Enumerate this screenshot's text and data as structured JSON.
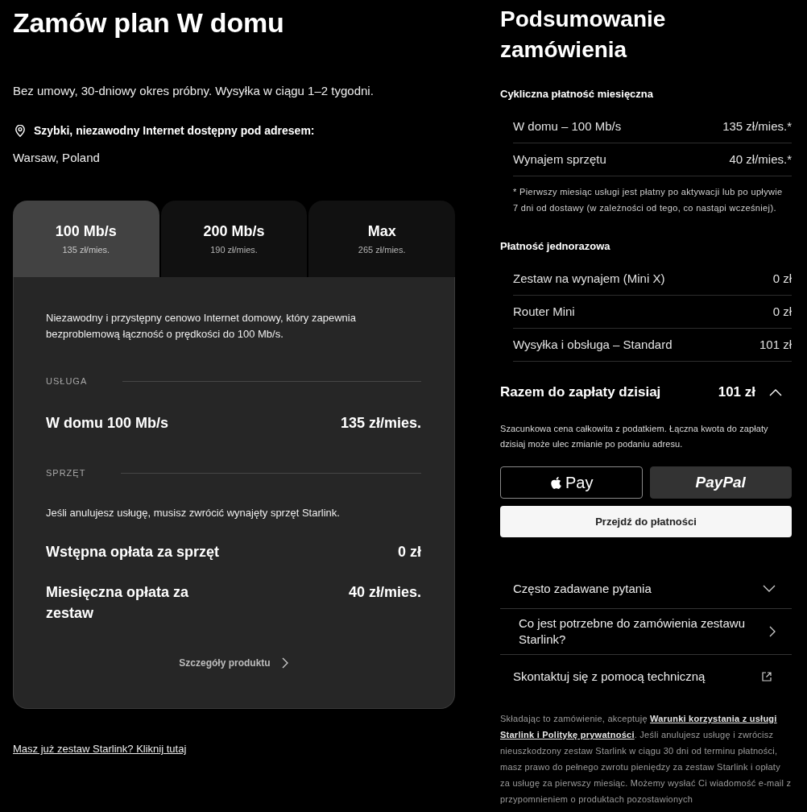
{
  "plan": {
    "title": "Zamów plan W domu",
    "subtitle": "Bez umowy, 30-dniowy okres próbny. Wysyłka w ciągu 1–2 tygodni.",
    "availability": "Szybki, niezawodny Internet dostępny pod adresem:",
    "address": "Warsaw, Poland",
    "tabs": [
      {
        "label": "100 Mb/s",
        "price": "135 zł/mies.",
        "selected": true
      },
      {
        "label": "200 Mb/s",
        "price": "190 zł/mies.",
        "selected": false
      },
      {
        "label": "Max",
        "price": "265 zł/mies.",
        "selected": false
      }
    ],
    "details": {
      "description": "Niezawodny i przystępny cenowo Internet domowy, który zapewnia bezproblemową łączność o prędkości do 100 Mb/s.",
      "sections": [
        {
          "heading": "USŁUGA",
          "rows": [
            {
              "label": "W domu 100 Mb/s",
              "value": "135 zł/mies."
            }
          ]
        },
        {
          "heading": "SPRZĘT",
          "note": "Jeśli anulujesz usługę, musisz zwrócić wynajęty sprzęt Starlink.",
          "rows": [
            {
              "label": "Wstępna opłata za sprzęt",
              "value": "0 zł"
            },
            {
              "label": "Miesięczna opłata za zestaw",
              "value": "40 zł/mies."
            }
          ]
        }
      ],
      "link": "Szczegóły produktu"
    },
    "existing_kit_link": "Masz już zestaw Starlink? Kliknij tutaj"
  },
  "summary": {
    "title": "Podsumowanie zamówienia",
    "groups": [
      {
        "heading": "Cykliczna płatność miesięczna",
        "rows": [
          {
            "label": "W domu – 100 Mb/s",
            "value": "135 zł/mies.*"
          },
          {
            "label": "Wynajem sprzętu",
            "value": "40 zł/mies.*"
          }
        ],
        "footnote": "* Pierwszy miesiąc usługi jest płatny po aktywacji lub po upływie 7 dni od dostawy (w zależności od tego, co nastąpi wcześniej)."
      },
      {
        "heading": "Płatność jednorazowa",
        "rows": [
          {
            "label": "Zestaw na wynajem (Mini X)",
            "value": "0 zł"
          },
          {
            "label": "Router Mini",
            "value": "0 zł"
          },
          {
            "label": "Wysyłka i obsługa – Standard",
            "value": "101 zł"
          }
        ]
      }
    ],
    "total": {
      "label": "Razem do zapłaty dzisiaj",
      "amount": "101 zł",
      "expanded": true
    },
    "tax_note": "Szacunkowa cena całkowita z podatkiem. Łączna kwota do zapłaty dzisiaj może ulec zmianie po podaniu adresu.",
    "wallet_buttons": [
      {
        "kind": "apple_pay",
        "label": "Pay"
      },
      {
        "kind": "paypal",
        "label": "PayPal"
      }
    ],
    "checkout_button": "Przejdź do płatności",
    "help_items": [
      {
        "kind": "accordion",
        "label": "Często zadawane pytania"
      },
      {
        "kind": "question",
        "label": "Co jest potrzebne do zamówienia zestawu Starlink?"
      },
      {
        "kind": "external",
        "label": "Skontaktuj się z pomocą techniczną"
      }
    ],
    "legal": {
      "before": "Składając to zamówienie, akceptuję",
      "links": [
        "Warunki korzystania z usługi",
        "Starlink i Politykę prywatności"
      ],
      "after": ". Jeśli anulujesz usługę i zwrócisz nieuszkodzony zestaw Starlink w ciągu 30 dni od terminu płatności, masz prawo do pełnego zwrotu pieniędzy za zestaw Starlink i opłaty za usługę za pierwszy miesiąc. Możemy wysłać Ci wiadomość e-mail z przypomnieniem o produktach pozostawionych"
    }
  }
}
